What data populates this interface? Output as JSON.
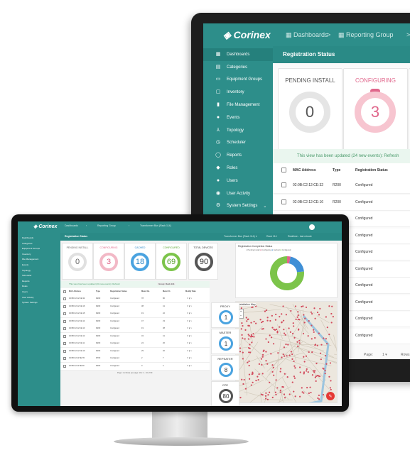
{
  "back": {
    "brand": "Corinex",
    "breadcrumb": [
      "Dashboards",
      ">",
      "Reporting Group",
      ">"
    ],
    "sidebar": [
      {
        "icon": "▦",
        "label": "Dashboards",
        "name": "dashboards"
      },
      {
        "icon": "▤",
        "label": "Categories",
        "name": "categories"
      },
      {
        "icon": "▭",
        "label": "Equipment Groups",
        "name": "equipment-groups"
      },
      {
        "icon": "▢",
        "label": "Inventory",
        "name": "inventory"
      },
      {
        "icon": "▮",
        "label": "File Management",
        "name": "file-management"
      },
      {
        "icon": "●",
        "label": "Events",
        "name": "events"
      },
      {
        "icon": "⅄",
        "label": "Topology",
        "name": "topology"
      },
      {
        "icon": "◷",
        "label": "Scheduler",
        "name": "scheduler"
      },
      {
        "icon": "◯",
        "label": "Reports",
        "name": "reports"
      },
      {
        "icon": "◆",
        "label": "Roles",
        "name": "roles"
      },
      {
        "icon": "●",
        "label": "Users",
        "name": "users"
      },
      {
        "icon": "◉",
        "label": "User Activity",
        "name": "user-activity"
      },
      {
        "icon": "⚙",
        "label": "System Settings",
        "name": "system-settings"
      }
    ],
    "system_settings_chevron": "⌄",
    "page_title": "Registration Status",
    "cards": [
      {
        "title": "PENDING INSTALL",
        "value": "0",
        "color": "#e5e5e5",
        "text_color": "#555555"
      },
      {
        "title": "CONFIGURING",
        "value": "3",
        "color": "#f7c5d0",
        "text_color": "#e0668b"
      }
    ],
    "banner": "This view has been updated (24 new events): Refresh",
    "columns": [
      "MAC Address",
      "Type",
      "Registration Status"
    ],
    "rows": [
      {
        "mac": "02:0B:C2:12:CE:32",
        "type": "R200",
        "status": "Configured"
      },
      {
        "mac": "02:0B:C2:12:CE:16",
        "type": "R200",
        "status": "Configured"
      },
      {
        "mac": "02:0B:C2:12:CE:15",
        "type": "R200",
        "status": "Configured"
      },
      {
        "mac": "",
        "type": "200",
        "status": "Configured"
      },
      {
        "mac": "",
        "type": "00",
        "status": "Configured"
      },
      {
        "mac": "",
        "type": "00",
        "status": "Configured"
      },
      {
        "mac": "",
        "type": "00",
        "status": "Configured"
      },
      {
        "mac": "",
        "type": "00",
        "status": "Configured"
      },
      {
        "mac": "",
        "type": "00",
        "status": "Configured"
      },
      {
        "mac": "",
        "type": "000",
        "status": "Configured"
      }
    ],
    "pager": {
      "page_label": "Page:",
      "page_value": "1 ▾",
      "rows_label": "Rows"
    }
  },
  "front": {
    "brand": "Corinex",
    "breadcrumb": [
      "Dashboards",
      "›",
      "Reporting Group",
      "›",
      "Transformer Bus (Rack 114)"
    ],
    "toolbar": [
      "Transformer Bus (Rack 114) ▾",
      "Rack 114",
      "Realtime - last minute"
    ],
    "sidebar": [
      "Dashboards",
      "Categories",
      "Equipment Groups",
      "Inventory",
      "File Management",
      "Events",
      "Topology",
      "Scheduler",
      "Reports",
      "Roles",
      "Users",
      "User Activity",
      "System Settings"
    ],
    "page_title": "Registration Status",
    "cards": [
      {
        "title": "PENDING INSTALL",
        "value": "0",
        "color": "#e0e0e0",
        "text_color": "#666666"
      },
      {
        "title": "CONFIGURING",
        "value": "3",
        "color": "#f2b8c6",
        "text_color": "#e0668b"
      },
      {
        "title": "CACHED",
        "value": "18",
        "color": "#4aa3e0",
        "text_color": "#2a86c8"
      },
      {
        "title": "CONFIGURED",
        "value": "69",
        "color": "#7cc44a",
        "text_color": "#5aa530"
      },
      {
        "title": "TOTAL DEVICES",
        "value": "90",
        "color": "#555555",
        "text_color": "#333333"
      }
    ],
    "completion": {
      "title": "Registration Completion Status",
      "legend": [
        "Pending Install",
        "Configuring",
        "Cached",
        "Configured"
      ],
      "donut": [
        {
          "label": "Pending Install",
          "value": 0,
          "color": "#bdbdbd"
        },
        {
          "label": "Configuring",
          "value": 3,
          "color": "#e0668b"
        },
        {
          "label": "Cached",
          "value": 18,
          "color": "#3f8fd6"
        },
        {
          "label": "Configured",
          "value": 69,
          "color": "#7cc44a"
        }
      ]
    },
    "banner": "This view has been updated (24 new events): Refresh",
    "filter": "Group: Rack 114",
    "columns": [
      "MAC Address",
      "Type",
      "Registration Status",
      "Meter No.",
      "Meter Ct.",
      "Modify Date"
    ],
    "rows": [
      {
        "mac": "02:0B:C2:12:CE:32",
        "type": "R200",
        "status": "Configured",
        "a": "78",
        "b": "80"
      },
      {
        "mac": "02:0B:C2:12:CE:16",
        "type": "R200",
        "status": "Configured",
        "a": "38",
        "b": "41"
      },
      {
        "mac": "02:0B:C2:12:CE:15",
        "type": "R200",
        "status": "Configured",
        "a": "19",
        "b": "22"
      },
      {
        "mac": "02:0B:C2:12:CE:14",
        "type": "R200",
        "status": "Configured",
        "a": "47",
        "b": "23"
      },
      {
        "mac": "02:0B:C2:12:CE:13",
        "type": "R200",
        "status": "Configured",
        "a": "19",
        "b": "38"
      },
      {
        "mac": "02:0B:C2:12:CE:12",
        "type": "R200",
        "status": "Configured",
        "a": "34",
        "b": "41"
      },
      {
        "mac": "02:0B:C2:12:CE:11",
        "type": "R200",
        "status": "Configured",
        "a": "24",
        "b": "26"
      },
      {
        "mac": "02:0B:C2:12:CE:10",
        "type": "R200",
        "status": "Configured",
        "a": "29",
        "b": "40"
      },
      {
        "mac": "02:0B:C2:11:5E:7D",
        "type": "R700",
        "status": "Configured",
        "a": "2",
        "b": "7"
      },
      {
        "mac": "02:0B:C2:11:5E:90",
        "type": "R200",
        "status": "Configured",
        "a": "3",
        "b": "4"
      }
    ],
    "pager": "Page: 1 ▾   Rows per page: 10 ▾   1 - 10 of 90",
    "types": [
      {
        "label": "PROXY",
        "value": "1",
        "color": "#4aa3e0"
      },
      {
        "label": "MASTER",
        "value": "1",
        "color": "#4aa3e0"
      },
      {
        "label": "REPEATER",
        "value": "8",
        "color": "#4aa3e0"
      },
      {
        "label": "CPE",
        "value": "80",
        "color": "#555555"
      }
    ],
    "map": {
      "title": "Installation Map",
      "zoom_in": "+",
      "zoom_out": "−"
    },
    "fab": "✎"
  }
}
